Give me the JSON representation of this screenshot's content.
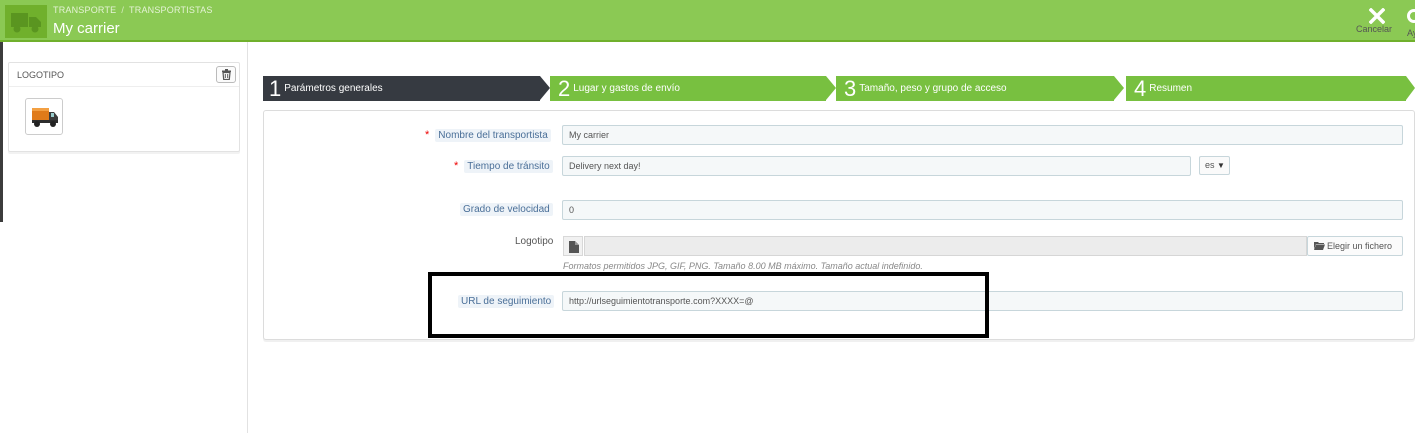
{
  "header": {
    "breadcrumb": [
      "TRANSPORTE",
      "TRANSPORTISTAS"
    ],
    "breadcrumb_sep": "/",
    "title": "My carrier",
    "cancel_label": "Cancelar",
    "help_label": "Ay",
    "bg_color": "#8bc954"
  },
  "logo_panel": {
    "title": "LOGOTIPO",
    "trash_icon": "trash-icon",
    "thumbnail_icon": "truck-icon"
  },
  "steps": [
    {
      "number": "1",
      "label": "Parámetros generales",
      "active": true
    },
    {
      "number": "2",
      "label": "Lugar y gastos de envío",
      "active": false
    },
    {
      "number": "3",
      "label": "Tamaño, peso y grupo de acceso",
      "active": false
    },
    {
      "number": "4",
      "label": "Resumen",
      "active": false
    }
  ],
  "form": {
    "name": {
      "label": "Nombre del transportista",
      "required": "*",
      "value": "My carrier"
    },
    "transit": {
      "label": "Tiempo de tránsito",
      "required": "*",
      "value": "Delivery next day!",
      "lang": "es"
    },
    "speed": {
      "label": "Grado de velocidad",
      "value": "0"
    },
    "logo": {
      "label": "Logotipo",
      "button": "Elegir un fichero",
      "help": "Formatos permitidos JPG, GIF, PNG. Tamaño 8.00 MB máximo. Tamaño actual indefinido."
    },
    "tracking": {
      "label": "URL de seguimiento",
      "value": "http://urlseguimientotransporte.com?XXXX=@"
    }
  },
  "colors": {
    "step_active": "#363a41",
    "step_inactive": "#78c040",
    "required": "#e00000"
  }
}
